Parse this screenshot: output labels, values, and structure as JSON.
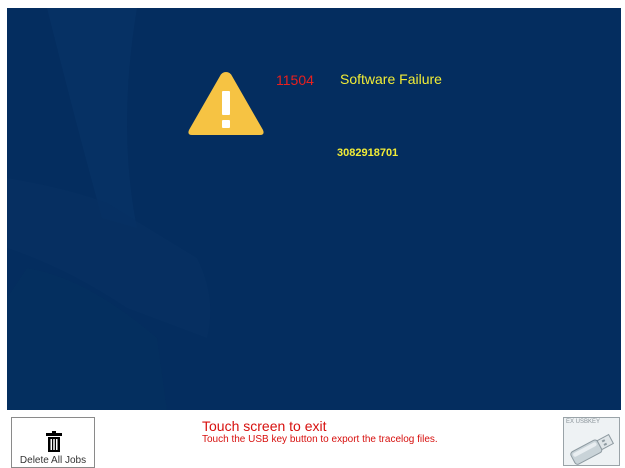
{
  "error": {
    "code": "11504",
    "title": "Software Failure",
    "number": "3082918701"
  },
  "footer": {
    "exit_text": "Touch screen to exit",
    "usb_hint": "Touch the USB key button to export the tracelog files.",
    "delete_label": "Delete All Jobs",
    "usb_label": "EX USBKEY"
  },
  "icons": {
    "warning": "warning-triangle-icon",
    "delete": "trash-icon",
    "usb": "usb-key-icon"
  },
  "colors": {
    "background": "#042d5f",
    "warning": "#f6c343",
    "code": "#e8201e",
    "title": "#f2ec36",
    "message": "#d7100e"
  }
}
